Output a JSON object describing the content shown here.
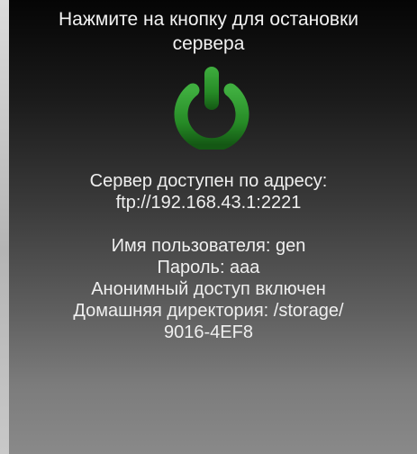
{
  "instruction": {
    "line1": "Нажмите на кнопку для остановки",
    "line2": "сервера"
  },
  "power_button": {
    "icon": "power-icon",
    "color": "#2e8b2e"
  },
  "server_info": {
    "address_label": "Сервер доступен по адресу:",
    "address_value": "ftp://192.168.43.1:2221"
  },
  "credentials": {
    "username": "Имя пользователя: gen",
    "password": "Пароль: aaa",
    "anonymous": "Анонимный доступ включен",
    "home_dir_line1": "Домашняя директория: /storage/",
    "home_dir_line2": "9016-4EF8"
  }
}
